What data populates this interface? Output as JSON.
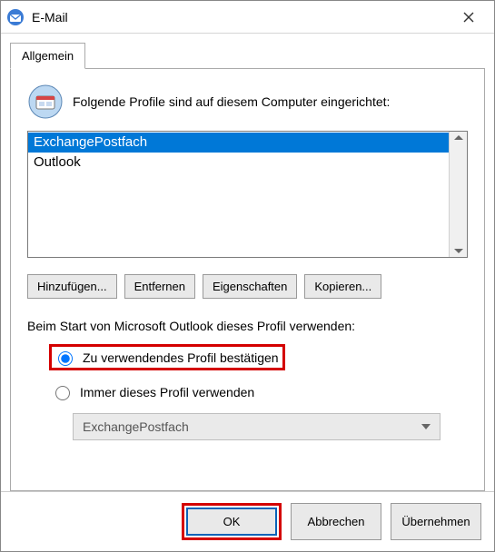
{
  "window": {
    "title": "E-Mail"
  },
  "tabs": {
    "general": "Allgemein"
  },
  "intro": "Folgende Profile sind auf diesem Computer eingerichtet:",
  "profiles": {
    "items": [
      "ExchangePostfach",
      "Outlook"
    ],
    "selected_index": 0
  },
  "buttons": {
    "add": "Hinzufügen...",
    "remove": "Entfernen",
    "properties": "Eigenschaften",
    "copy": "Kopieren..."
  },
  "startup": {
    "label": "Beim Start von Microsoft Outlook dieses Profil verwenden:",
    "option_prompt": "Zu verwendendes Profil bestätigen",
    "option_always": "Immer dieses Profil verwenden",
    "selected": "prompt",
    "dropdown_value": "ExchangePostfach",
    "dropdown_enabled": false
  },
  "footer": {
    "ok": "OK",
    "cancel": "Abbrechen",
    "apply": "Übernehmen"
  }
}
